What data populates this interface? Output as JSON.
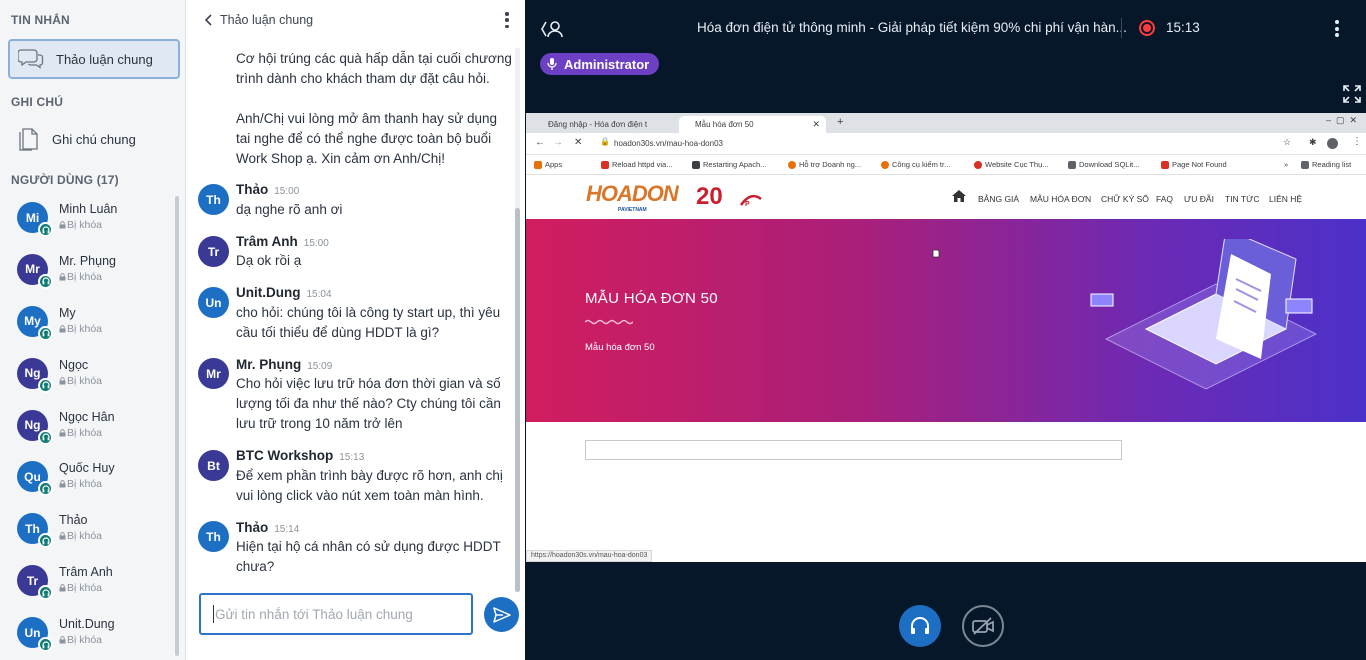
{
  "sidebar": {
    "messages_title": "TIN NHẮN",
    "public_chat_label": "Thảo luận chung",
    "notes_title": "GHI CHÚ",
    "shared_notes_label": "Ghi chú chung",
    "users_title": "NGƯỜI DÙNG (17)",
    "users": [
      {
        "initials": "Mi",
        "name": "Minh Luân",
        "status": "Bị khóa",
        "color": "blue"
      },
      {
        "initials": "Mr",
        "name": "Mr. Phụng",
        "status": "Bị khóa",
        "color": "purple"
      },
      {
        "initials": "My",
        "name": "My",
        "status": "Bị khóa",
        "color": "blue"
      },
      {
        "initials": "Ng",
        "name": "Ngọc",
        "status": "Bị khóa",
        "color": "purple"
      },
      {
        "initials": "Ng",
        "name": "Ngọc Hân",
        "status": "Bị khóa",
        "color": "purple"
      },
      {
        "initials": "Qu",
        "name": "Quốc Huy",
        "status": "Bị khóa",
        "color": "blue"
      },
      {
        "initials": "Th",
        "name": "Thảo",
        "status": "Bị khóa",
        "color": "blue"
      },
      {
        "initials": "Tr",
        "name": "Trâm Anh",
        "status": "Bị khóa",
        "color": "purple"
      },
      {
        "initials": "Un",
        "name": "Unit.Dung",
        "status": "Bị khóa",
        "color": "blue"
      }
    ]
  },
  "chat": {
    "title": "Thảo luận chung",
    "intro_lines": [
      "Cơ hội trúng các quà hấp dẫn tại cuối chương trình dành cho khách tham dự đặt câu hỏi.",
      "Anh/Chị vui lòng mở âm thanh hay sử dụng tai nghe để có thể nghe được toàn bộ buổi Work Shop ạ. Xin cảm ơn Anh/Chị!"
    ],
    "messages": [
      {
        "initials": "Th",
        "name": "Thảo",
        "time": "15:00",
        "text": "dạ nghe rõ anh ơi",
        "color": "blue"
      },
      {
        "initials": "Tr",
        "name": "Trâm Anh",
        "time": "15:00",
        "text": "Dạ ok rồi ạ",
        "color": "purple"
      },
      {
        "initials": "Un",
        "name": "Unit.Dung",
        "time": "15:04",
        "text": "cho hỏi: chúng tôi là công ty start up, thì yêu cầu tối thiểu để dùng HDDT là gì?",
        "color": "blue"
      },
      {
        "initials": "Mr",
        "name": "Mr. Phụng",
        "time": "15:09",
        "text": "Cho hỏi việc lưu trữ hóa đơn thời gian và số lượng tối đa như thế nào? Cty chúng tôi cần lưu trữ trong 10 năm trở lên",
        "color": "purple"
      },
      {
        "initials": "Bt",
        "name": "BTC Workshop",
        "time": "15:13",
        "text": "Để xem phần trình bày được rõ hơn, anh chị vui lòng click vào nút xem toàn màn hình.",
        "color": "purple"
      },
      {
        "initials": "Th",
        "name": "Thảo",
        "time": "15:14",
        "text": "Hiện tại hộ cá nhân có sử dụng được HDDT chưa?",
        "color": "blue"
      }
    ],
    "input_placeholder": "Gửi tin nhắn tới Thảo luận chung"
  },
  "presentation": {
    "title": "Hóa đơn điện tử thông minh - Giải pháp tiết kiệm 90% chi phí vận hàn...",
    "recording_time": "15:13",
    "presenter": "Administrator"
  },
  "browser": {
    "tabs": [
      "Đăng nhập - Hóa đơn điện t",
      "Mẫu hóa đơn 50"
    ],
    "url": "hoadon30s.vn/mau-hoa-don03",
    "bookmarks": [
      "Apps",
      "Reload httpd via...",
      "Restarting Apach...",
      "Hỗ trợ Doanh ng...",
      "Công cụ kiểm tr...",
      "Website Cục Thụ...",
      "Download SQLit...",
      "Page Not Found",
      "Reading list"
    ],
    "status_url": "https://hoadon30s.vn/mau-hoa-don03"
  },
  "site": {
    "logo": "HOADON",
    "logo_sub": "PAVIETNAM",
    "logo_20": "20",
    "nav": [
      "BẢNG GIÁ",
      "MẪU HÓA ĐƠN",
      "CHỮ KÝ SỐ",
      "FAQ",
      "ƯU ĐÃI",
      "TIN TỨC",
      "LIÊN HỆ"
    ],
    "hero_title": "MẪU HÓA ĐƠN 50",
    "hero_subtitle": "Mẫu hóa đơn 50"
  },
  "colors": {
    "accent": "#1d6fc4",
    "avatar_purple": "#3a3a96",
    "recording": "#ff3b3b",
    "presenter_pill": "#6c3fc4",
    "dark_bg": "#06172a"
  }
}
